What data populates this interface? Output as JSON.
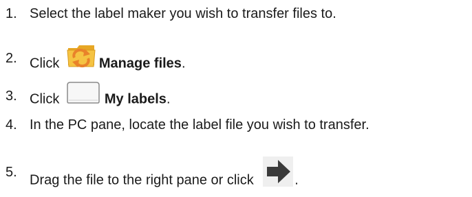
{
  "steps": [
    {
      "number": "1.",
      "text": "Select the label maker you wish to transfer files to."
    },
    {
      "number": "2.",
      "before": "Click",
      "icon": "manage-files-folder-icon",
      "bold": "Manage files",
      "after": "."
    },
    {
      "number": "3.",
      "before": "Click",
      "icon": "my-labels-label-icon",
      "bold": "My labels",
      "after": "."
    },
    {
      "number": "4.",
      "text": "In the PC pane, locate the label file you wish to transfer."
    },
    {
      "number": "5.",
      "before": "Drag the file to the right pane or click",
      "icon": "transfer-arrow-icon",
      "after": "."
    }
  ],
  "colors": {
    "text": "#1a1a1a",
    "folder_yellow": "#f5c342",
    "sync_orange": "#e9822a",
    "arrow_box": "#4a4a4a"
  }
}
